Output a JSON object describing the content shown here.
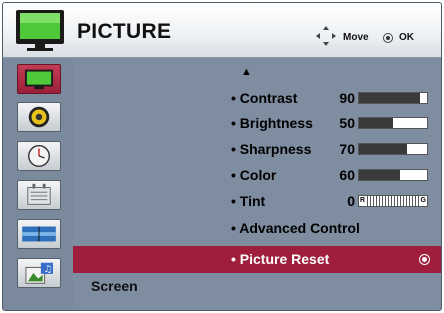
{
  "header": {
    "title": "PICTURE",
    "move_label": "Move",
    "ok_label": "OK",
    "icon": "monitor-icon"
  },
  "sidebar": {
    "items": [
      {
        "icon": "picture-icon",
        "selected": true
      },
      {
        "icon": "audio-speaker-icon",
        "selected": false
      },
      {
        "icon": "clock-icon",
        "selected": false
      },
      {
        "icon": "options-icon",
        "selected": false
      },
      {
        "icon": "input-icon",
        "selected": false
      },
      {
        "icon": "photo-music-icon",
        "selected": false
      }
    ]
  },
  "menu": {
    "scroll_up": "▲",
    "items": [
      {
        "label": "• Contrast",
        "value": "90",
        "level": 90
      },
      {
        "label": "• Brightness",
        "value": "50",
        "level": 50
      },
      {
        "label": "• Sharpness",
        "value": "70",
        "level": 70
      },
      {
        "label": "• Color",
        "value": "60",
        "level": 60
      },
      {
        "label": "• Tint",
        "value": "0",
        "tint_left": "R",
        "tint_right": "G"
      },
      {
        "label": "• Advanced Control"
      },
      {
        "label": "• Picture Reset",
        "highlighted": true
      }
    ],
    "section_label": "Screen"
  },
  "colors": {
    "highlight": "#9e1e3c",
    "panel": "#7e8da0",
    "header": "#ffffff"
  }
}
